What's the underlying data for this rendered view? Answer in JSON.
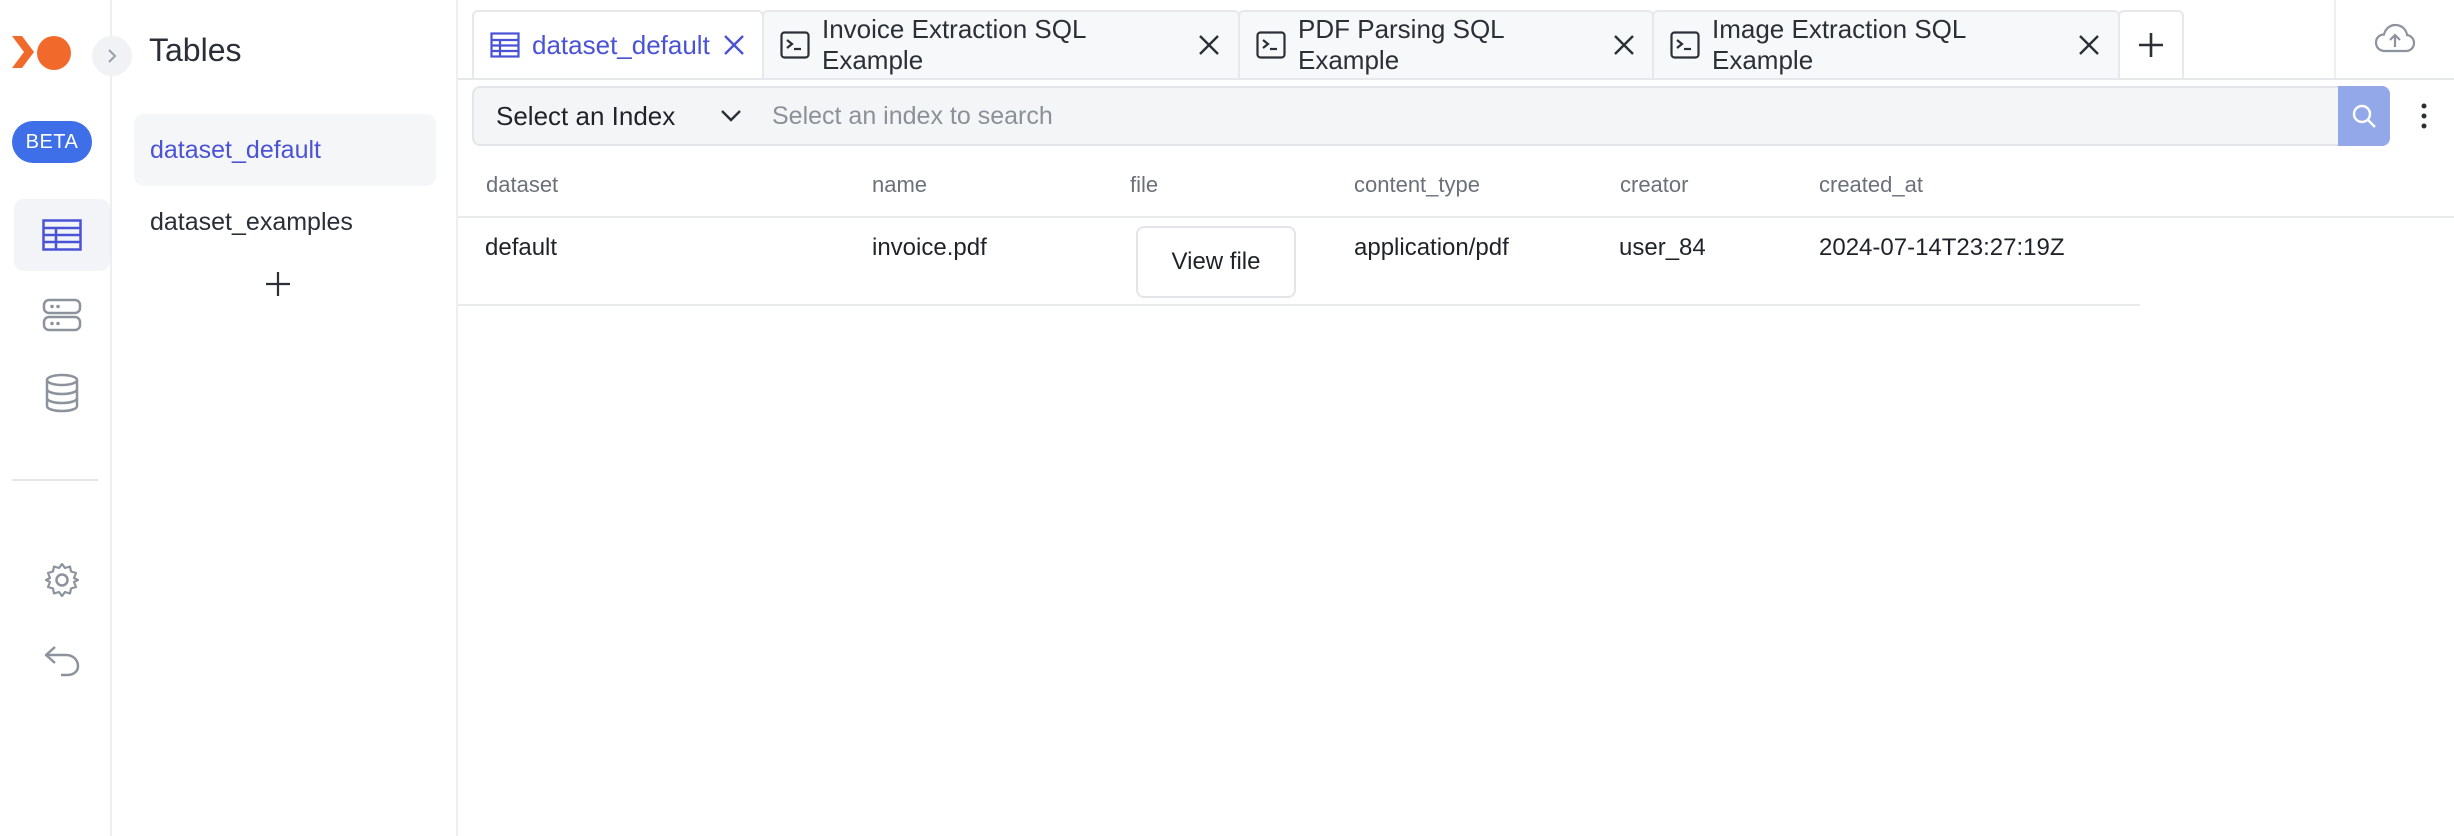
{
  "brand": {
    "badge": "BETA"
  },
  "rail": {
    "items": [
      {
        "icon": "table-icon",
        "active": true
      },
      {
        "icon": "server-icon",
        "active": false
      },
      {
        "icon": "database-icon",
        "active": false
      }
    ],
    "bottom": [
      {
        "icon": "gear-icon"
      },
      {
        "icon": "undo-icon"
      }
    ]
  },
  "tables_panel": {
    "title": "Tables",
    "items": [
      {
        "label": "dataset_default",
        "active": true
      },
      {
        "label": "dataset_examples",
        "active": false
      }
    ]
  },
  "tabs": [
    {
      "label": "dataset_default",
      "icon": "table-icon",
      "active": true
    },
    {
      "label": "Invoice Extraction SQL Example",
      "icon": "terminal-icon",
      "active": false
    },
    {
      "label": "PDF Parsing SQL Example",
      "icon": "terminal-icon",
      "active": false
    },
    {
      "label": "Image Extraction SQL Example",
      "icon": "terminal-icon",
      "active": false
    }
  ],
  "search": {
    "index_select": "Select an Index",
    "placeholder": "Select an index to search"
  },
  "table": {
    "columns": [
      "dataset",
      "name",
      "file",
      "content_type",
      "creator",
      "created_at"
    ],
    "rows": [
      {
        "dataset": "default",
        "name": "invoice.pdf",
        "file": "View file",
        "content_type": "application/pdf",
        "creator": "user_84",
        "created_at": "2024-07-14T23:27:19Z"
      }
    ]
  },
  "colors": {
    "accent": "#4a52d6",
    "beta": "#3f6fe8",
    "logo": "#f26a2b",
    "search_button": "#93a8e9"
  }
}
